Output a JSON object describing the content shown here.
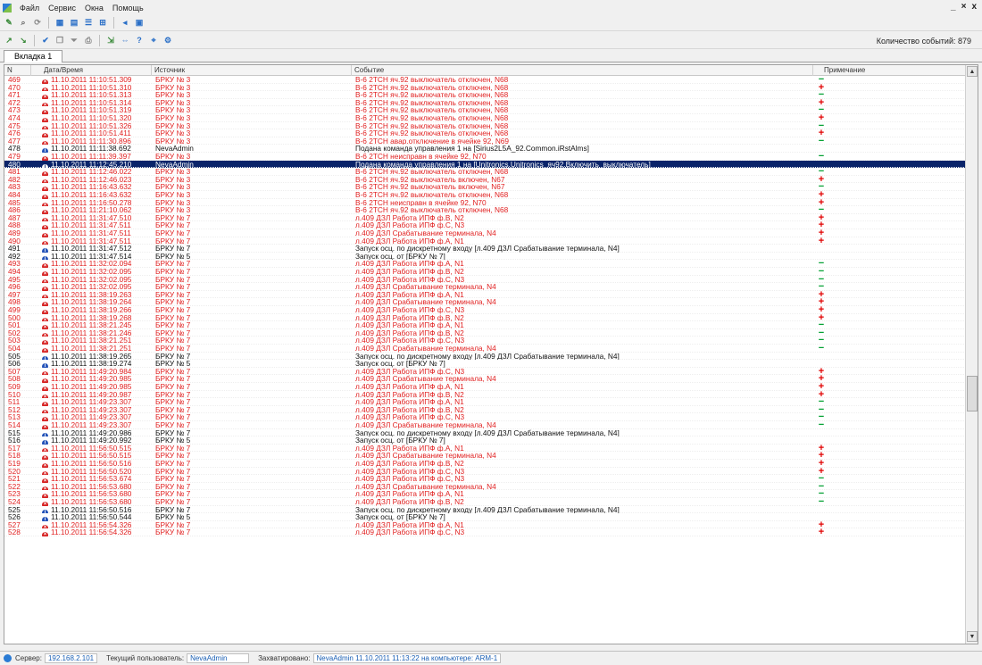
{
  "menu": [
    "Файл",
    "Сервис",
    "Окна",
    "Помощь"
  ],
  "window_controls": [
    "_",
    "×",
    "x"
  ],
  "toolbar1": {
    "icons": [
      {
        "name": "edit-icon",
        "glyph": "✎",
        "color": "#3a8a3a"
      },
      {
        "name": "search-icon",
        "glyph": "⌕",
        "color": "#666"
      },
      {
        "name": "refresh-icon",
        "glyph": "⟳",
        "color": "#888"
      },
      {
        "name": "grid-icon",
        "glyph": "▦",
        "color": "#2a6fc7"
      },
      {
        "name": "table-icon",
        "glyph": "▤",
        "color": "#2a6fc7"
      },
      {
        "name": "list-icon",
        "glyph": "☰",
        "color": "#2a6fc7"
      },
      {
        "name": "tree-icon",
        "glyph": "⊞",
        "color": "#2a6fc7"
      },
      {
        "name": "sound-icon",
        "glyph": "◂",
        "color": "#2a6fc7"
      },
      {
        "name": "monitor-icon",
        "glyph": "▣",
        "color": "#2a6fc7"
      }
    ]
  },
  "toolbar2": {
    "icons": [
      {
        "name": "filter-add-icon",
        "glyph": "↗",
        "color": "#3a8a3a"
      },
      {
        "name": "filter-remove-icon",
        "glyph": "↘",
        "color": "#3a8a3a"
      },
      {
        "name": "acknowledge-icon",
        "glyph": "✔",
        "color": "#2a6fc7"
      },
      {
        "name": "copy-icon",
        "glyph": "❐",
        "color": "#888"
      },
      {
        "name": "funnel-icon",
        "glyph": "⏷",
        "color": "#888"
      },
      {
        "name": "print-icon",
        "glyph": "⎙",
        "color": "#888"
      },
      {
        "name": "export-icon",
        "glyph": "⇲",
        "color": "#3a8a3a"
      },
      {
        "name": "navigate-icon",
        "glyph": "⇔",
        "color": "#2a6fc7"
      },
      {
        "name": "help-icon",
        "glyph": "?",
        "color": "#2a6fc7"
      },
      {
        "name": "zoom-icon",
        "glyph": "⌖",
        "color": "#2a6fc7"
      },
      {
        "name": "settings-icon",
        "glyph": "⚙",
        "color": "#2a6fc7"
      }
    ]
  },
  "event_count_label": "Количество событий: 879",
  "tab_label": "Вкладка 1",
  "columns": {
    "n": "N",
    "time": "Дата/Время",
    "source": "Источник",
    "event": "Событие",
    "note": "Примечание"
  },
  "rows": [
    {
      "n": "469",
      "time": "11.10.2011 11:10:51.309",
      "source": "БРКУ № 3",
      "event": "В-6 2ТСН яч.92 выключатель отключен, N68",
      "level": "alarm",
      "mark": "minus"
    },
    {
      "n": "470",
      "time": "11.10.2011 11:10:51.310",
      "source": "БРКУ № 3",
      "event": "В-6 2ТСН яч.92 выключатель отключен, N68",
      "level": "alarm",
      "mark": "plus"
    },
    {
      "n": "471",
      "time": "11.10.2011 11:10:51.313",
      "source": "БРКУ № 3",
      "event": "В-6 2ТСН яч.92 выключатель отключен, N68",
      "level": "alarm",
      "mark": "minus"
    },
    {
      "n": "472",
      "time": "11.10.2011 11:10:51.314",
      "source": "БРКУ № 3",
      "event": "В-6 2ТСН яч.92 выключатель отключен, N68",
      "level": "alarm",
      "mark": "plus"
    },
    {
      "n": "473",
      "time": "11.10.2011 11:10:51.319",
      "source": "БРКУ № 3",
      "event": "В-6 2ТСН яч.92 выключатель отключен, N68",
      "level": "alarm",
      "mark": "minus"
    },
    {
      "n": "474",
      "time": "11.10.2011 11:10:51.320",
      "source": "БРКУ № 3",
      "event": "В-6 2ТСН яч.92 выключатель отключен, N68",
      "level": "alarm",
      "mark": "plus"
    },
    {
      "n": "475",
      "time": "11.10.2011 11:10:51.326",
      "source": "БРКУ № 3",
      "event": "В-6 2ТСН яч.92 выключатель отключен, N68",
      "level": "alarm",
      "mark": "minus"
    },
    {
      "n": "476",
      "time": "11.10.2011 11:10:51.411",
      "source": "БРКУ № 3",
      "event": "В-6 2ТСН яч.92 выключатель отключен, N68",
      "level": "alarm",
      "mark": "plus"
    },
    {
      "n": "477",
      "time": "11.10.2011 11:11:30.896",
      "source": "БРКУ № 3",
      "event": "В-6 2ТСН авар.отключение в ячейке 92, N69",
      "level": "alarm",
      "mark": "minus"
    },
    {
      "n": "478",
      "time": "11.10.2011 11:11:38.692",
      "source": "NevaAdmin",
      "event": "Подана команда управления 1 на [Sirius2L5A_92.Common.iRstAlms]",
      "level": "info",
      "mark": ""
    },
    {
      "n": "479",
      "time": "11.10.2011 11:11:39.397",
      "source": "БРКУ № 3",
      "event": "В-6 2ТСН неисправн в ячейке 92, N70",
      "level": "alarm",
      "mark": "minus"
    },
    {
      "n": "480",
      "time": "11.10.2011 11:12:45.210",
      "source": "NevaAdmin",
      "event": "Подана команда управления 1 на [Unitronics.Unitronics_яч92.Включить_выключатель]",
      "level": "info",
      "mark": "",
      "selected": true
    },
    {
      "n": "481",
      "time": "11.10.2011 11:12:46.022",
      "source": "БРКУ № 3",
      "event": "В-6 2ТСН яч.92 выключатель отключен, N68",
      "level": "alarm",
      "mark": "minus"
    },
    {
      "n": "482",
      "time": "11.10.2011 11:12:46.023",
      "source": "БРКУ № 3",
      "event": "В-6 2ТСН яч.92 выключатель включен, N67",
      "level": "alarm",
      "mark": "plus"
    },
    {
      "n": "483",
      "time": "11.10.2011 11:16:43.632",
      "source": "БРКУ № 3",
      "event": "В-6 2ТСН яч.92 выключатель включен, N67",
      "level": "alarm",
      "mark": "minus"
    },
    {
      "n": "484",
      "time": "11.10.2011 11:16:43.632",
      "source": "БРКУ № 3",
      "event": "В-6 2ТСН яч.92 выключатель отключен, N68",
      "level": "alarm",
      "mark": "plus"
    },
    {
      "n": "485",
      "time": "11.10.2011 11:16:50.278",
      "source": "БРКУ № 3",
      "event": "В-6 2ТСН неисправн в ячейке 92, N70",
      "level": "alarm",
      "mark": "plus"
    },
    {
      "n": "486",
      "time": "11.10.2011 11:21:10.062",
      "source": "БРКУ № 3",
      "event": "В-6 2ТСН яч.92 выключатель отключен, N68",
      "level": "alarm",
      "mark": "minus"
    },
    {
      "n": "487",
      "time": "11.10.2011 11:31:47.510",
      "source": "БРКУ № 7",
      "event": "л.409 ДЗЛ Работа ИПФ ф.В, N2",
      "level": "alarm",
      "mark": "plus"
    },
    {
      "n": "488",
      "time": "11.10.2011 11:31:47.511",
      "source": "БРКУ № 7",
      "event": "л.409 ДЗЛ Работа ИПФ ф.С, N3",
      "level": "alarm",
      "mark": "plus"
    },
    {
      "n": "489",
      "time": "11.10.2011 11:31:47.511",
      "source": "БРКУ № 7",
      "event": "л.409 ДЗЛ Срабатывание терминала, N4",
      "level": "alarm",
      "mark": "plus"
    },
    {
      "n": "490",
      "time": "11.10.2011 11:31:47.511",
      "source": "БРКУ № 7",
      "event": "л.409 ДЗЛ Работа ИПФ ф.А, N1",
      "level": "alarm",
      "mark": "plus"
    },
    {
      "n": "491",
      "time": "11.10.2011 11:31:47.512",
      "source": "БРКУ № 7",
      "event": "Запуск осц. по дискретному входу [л.409 ДЗЛ Срабатывание терминала, N4]",
      "level": "info",
      "mark": ""
    },
    {
      "n": "492",
      "time": "11.10.2011 11:31:47.514",
      "source": "БРКУ № 5",
      "event": "Запуск осц. от [БРКУ № 7]",
      "level": "info",
      "mark": ""
    },
    {
      "n": "493",
      "time": "11.10.2011 11:32:02.094",
      "source": "БРКУ № 7",
      "event": "л.409 ДЗЛ Работа ИПФ ф.А, N1",
      "level": "alarm",
      "mark": "minus"
    },
    {
      "n": "494",
      "time": "11.10.2011 11:32:02.095",
      "source": "БРКУ № 7",
      "event": "л.409 ДЗЛ Работа ИПФ ф.В, N2",
      "level": "alarm",
      "mark": "minus"
    },
    {
      "n": "495",
      "time": "11.10.2011 11:32:02.095",
      "source": "БРКУ № 7",
      "event": "л.409 ДЗЛ Работа ИПФ ф.С, N3",
      "level": "alarm",
      "mark": "minus"
    },
    {
      "n": "496",
      "time": "11.10.2011 11:32:02.095",
      "source": "БРКУ № 7",
      "event": "л.409 ДЗЛ Срабатывание терминала, N4",
      "level": "alarm",
      "mark": "minus"
    },
    {
      "n": "497",
      "time": "11.10.2011 11:38:19.263",
      "source": "БРКУ № 7",
      "event": "л.409 ДЗЛ Работа ИПФ ф.А, N1",
      "level": "alarm",
      "mark": "plus"
    },
    {
      "n": "498",
      "time": "11.10.2011 11:38:19.264",
      "source": "БРКУ № 7",
      "event": "л.409 ДЗЛ Срабатывание терминала, N4",
      "level": "alarm",
      "mark": "plus"
    },
    {
      "n": "499",
      "time": "11.10.2011 11:38:19.266",
      "source": "БРКУ № 7",
      "event": "л.409 ДЗЛ Работа ИПФ ф.С, N3",
      "level": "alarm",
      "mark": "plus"
    },
    {
      "n": "500",
      "time": "11.10.2011 11:38:19.268",
      "source": "БРКУ № 7",
      "event": "л.409 ДЗЛ Работа ИПФ ф.В, N2",
      "level": "alarm",
      "mark": "plus"
    },
    {
      "n": "501",
      "time": "11.10.2011 11:38:21.245",
      "source": "БРКУ № 7",
      "event": "л.409 ДЗЛ Работа ИПФ ф.А, N1",
      "level": "alarm",
      "mark": "minus"
    },
    {
      "n": "502",
      "time": "11.10.2011 11:38:21.246",
      "source": "БРКУ № 7",
      "event": "л.409 ДЗЛ Работа ИПФ ф.В, N2",
      "level": "alarm",
      "mark": "minus"
    },
    {
      "n": "503",
      "time": "11.10.2011 11:38:21.251",
      "source": "БРКУ № 7",
      "event": "л.409 ДЗЛ Работа ИПФ ф.С, N3",
      "level": "alarm",
      "mark": "minus"
    },
    {
      "n": "504",
      "time": "11.10.2011 11:38:21.251",
      "source": "БРКУ № 7",
      "event": "л.409 ДЗЛ Срабатывание терминала, N4",
      "level": "alarm",
      "mark": "minus"
    },
    {
      "n": "505",
      "time": "11.10.2011 11:38:19.265",
      "source": "БРКУ № 7",
      "event": "Запуск осц. по дискретному входу [л.409 ДЗЛ Срабатывание терминала, N4]",
      "level": "info",
      "mark": ""
    },
    {
      "n": "506",
      "time": "11.10.2011 11:38:19.274",
      "source": "БРКУ № 5",
      "event": "Запуск осц. от [БРКУ № 7]",
      "level": "info",
      "mark": ""
    },
    {
      "n": "507",
      "time": "11.10.2011 11:49:20.984",
      "source": "БРКУ № 7",
      "event": "л.409 ДЗЛ Работа ИПФ ф.С, N3",
      "level": "alarm",
      "mark": "plus"
    },
    {
      "n": "508",
      "time": "11.10.2011 11:49:20.985",
      "source": "БРКУ № 7",
      "event": "л.409 ДЗЛ Срабатывание терминала, N4",
      "level": "alarm",
      "mark": "plus"
    },
    {
      "n": "509",
      "time": "11.10.2011 11:49:20.985",
      "source": "БРКУ № 7",
      "event": "л.409 ДЗЛ Работа ИПФ ф.А, N1",
      "level": "alarm",
      "mark": "plus"
    },
    {
      "n": "510",
      "time": "11.10.2011 11:49:20.987",
      "source": "БРКУ № 7",
      "event": "л.409 ДЗЛ Работа ИПФ ф.В, N2",
      "level": "alarm",
      "mark": "plus"
    },
    {
      "n": "511",
      "time": "11.10.2011 11:49:23.307",
      "source": "БРКУ № 7",
      "event": "л.409 ДЗЛ Работа ИПФ ф.А, N1",
      "level": "alarm",
      "mark": "minus"
    },
    {
      "n": "512",
      "time": "11.10.2011 11:49:23.307",
      "source": "БРКУ № 7",
      "event": "л.409 ДЗЛ Работа ИПФ ф.В, N2",
      "level": "alarm",
      "mark": "minus"
    },
    {
      "n": "513",
      "time": "11.10.2011 11:49:23.307",
      "source": "БРКУ № 7",
      "event": "л.409 ДЗЛ Работа ИПФ ф.С, N3",
      "level": "alarm",
      "mark": "minus"
    },
    {
      "n": "514",
      "time": "11.10.2011 11:49:23.307",
      "source": "БРКУ № 7",
      "event": "л.409 ДЗЛ Срабатывание терминала, N4",
      "level": "alarm",
      "mark": "minus"
    },
    {
      "n": "515",
      "time": "11.10.2011 11:49:20.986",
      "source": "БРКУ № 7",
      "event": "Запуск осц. по дискретному входу [л.409 ДЗЛ Срабатывание терминала, N4]",
      "level": "info",
      "mark": ""
    },
    {
      "n": "516",
      "time": "11.10.2011 11:49:20.992",
      "source": "БРКУ № 5",
      "event": "Запуск осц. от [БРКУ № 7]",
      "level": "info",
      "mark": ""
    },
    {
      "n": "517",
      "time": "11.10.2011 11:56:50.515",
      "source": "БРКУ № 7",
      "event": "л.409 ДЗЛ Работа ИПФ ф.А, N1",
      "level": "alarm",
      "mark": "plus"
    },
    {
      "n": "518",
      "time": "11.10.2011 11:56:50.515",
      "source": "БРКУ № 7",
      "event": "л.409 ДЗЛ Срабатывание терминала, N4",
      "level": "alarm",
      "mark": "plus"
    },
    {
      "n": "519",
      "time": "11.10.2011 11:56:50.516",
      "source": "БРКУ № 7",
      "event": "л.409 ДЗЛ Работа ИПФ ф.В, N2",
      "level": "alarm",
      "mark": "plus"
    },
    {
      "n": "520",
      "time": "11.10.2011 11:56:50.520",
      "source": "БРКУ № 7",
      "event": "л.409 ДЗЛ Работа ИПФ ф.С, N3",
      "level": "alarm",
      "mark": "plus"
    },
    {
      "n": "521",
      "time": "11.10.2011 11:56:53.674",
      "source": "БРКУ № 7",
      "event": "л.409 ДЗЛ Работа ИПФ ф.С, N3",
      "level": "alarm",
      "mark": "minus"
    },
    {
      "n": "522",
      "time": "11.10.2011 11:56:53.680",
      "source": "БРКУ № 7",
      "event": "л.409 ДЗЛ Срабатывание терминала, N4",
      "level": "alarm",
      "mark": "minus"
    },
    {
      "n": "523",
      "time": "11.10.2011 11:56:53.680",
      "source": "БРКУ № 7",
      "event": "л.409 ДЗЛ Работа ИПФ ф.А, N1",
      "level": "alarm",
      "mark": "minus"
    },
    {
      "n": "524",
      "time": "11.10.2011 11:56:53.680",
      "source": "БРКУ № 7",
      "event": "л.409 ДЗЛ Работа ИПФ ф.В, N2",
      "level": "alarm",
      "mark": "minus"
    },
    {
      "n": "525",
      "time": "11.10.2011 11:56:50.516",
      "source": "БРКУ № 7",
      "event": "Запуск осц. по дискретному входу [л.409 ДЗЛ Срабатывание терминала, N4]",
      "level": "info",
      "mark": ""
    },
    {
      "n": "526",
      "time": "11.10.2011 11:56:50.544",
      "source": "БРКУ № 5",
      "event": "Запуск осц. от [БРКУ № 7]",
      "level": "info",
      "mark": ""
    },
    {
      "n": "527",
      "time": "11.10.2011 11:56:54.326",
      "source": "БРКУ № 7",
      "event": "л.409 ДЗЛ Работа ИПФ ф.А, N1",
      "level": "alarm",
      "mark": "plus"
    },
    {
      "n": "528",
      "time": "11.10.2011 11:56:54.326",
      "source": "БРКУ № 7",
      "event": "л.409 ДЗЛ Работа ИПФ ф.С, N3",
      "level": "alarm",
      "mark": "plus"
    }
  ],
  "status": {
    "server_label": "Сервер:",
    "server_value": "192.168.2.101",
    "user_label": "Текущий пользователь:",
    "user_value": "NevaAdmin",
    "locked_label": "Захватировано:",
    "locked_value": "NevaAdmin  11.10.2011 11:13:22  на компьютере: ARM-1"
  },
  "colors": {
    "alarm": "#e02020",
    "info": "#111111",
    "selected": "#0a246a",
    "plus": "#e00000",
    "minus": "#00a030"
  }
}
